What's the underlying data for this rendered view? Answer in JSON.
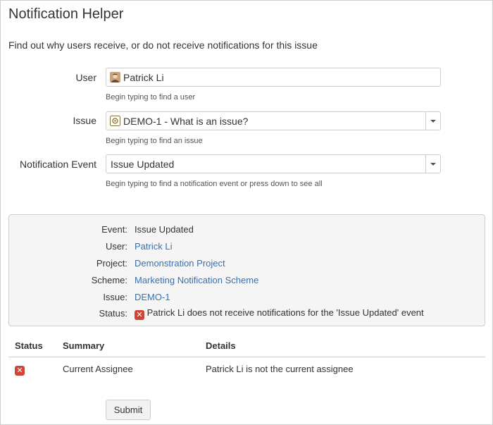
{
  "page": {
    "title": "Notification Helper",
    "description": "Find out why users receive, or do not receive notifications for this issue"
  },
  "form": {
    "user_label": "User",
    "user_value": "Patrick Li",
    "user_hint": "Begin typing to find a user",
    "issue_label": "Issue",
    "issue_value": "DEMO-1 - What is an issue?",
    "issue_hint": "Begin typing to find an issue",
    "event_label": "Notification Event",
    "event_value": "Issue Updated",
    "event_hint": "Begin typing to find a notification event or press down to see all"
  },
  "result": {
    "event_label": "Event:",
    "event_value": "Issue Updated",
    "user_label": "User:",
    "user_value": "Patrick Li",
    "project_label": "Project:",
    "project_value": "Demonstration Project",
    "scheme_label": "Scheme:",
    "scheme_value": "Marketing Notification Scheme",
    "issue_label": "Issue:",
    "issue_value": "DEMO-1",
    "status_label": "Status:",
    "status_value": "Patrick Li does not receive notifications for the 'Issue Updated' event",
    "status_icon": "error-x-icon",
    "status_color": "#d04437"
  },
  "table": {
    "headers": [
      "Status",
      "Summary",
      "Details"
    ],
    "rows": [
      {
        "status_icon": "error-x-icon",
        "summary": "Current Assignee",
        "details": "Patrick Li is not the current assignee"
      }
    ]
  },
  "actions": {
    "submit_label": "Submit"
  },
  "colors": {
    "link": "#3572b0",
    "error": "#d04437"
  }
}
